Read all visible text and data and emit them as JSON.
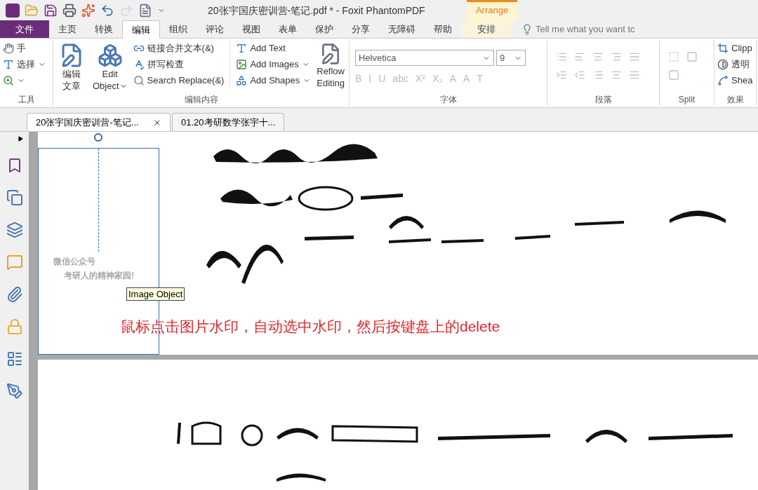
{
  "window": {
    "title": "20张宇国庆密训营-笔记.pdf * - Foxit PhantomPDF",
    "context_label": "Arrange"
  },
  "menu_tabs": [
    {
      "label": "文件",
      "kind": "file",
      "selected": false
    },
    {
      "label": "主页",
      "kind": "tab",
      "selected": false
    },
    {
      "label": "转换",
      "kind": "tab",
      "selected": false
    },
    {
      "label": "编辑",
      "kind": "tab",
      "selected": true
    },
    {
      "label": "组织",
      "kind": "tab",
      "selected": false
    },
    {
      "label": "评论",
      "kind": "tab",
      "selected": false
    },
    {
      "label": "视图",
      "kind": "tab",
      "selected": false
    },
    {
      "label": "表单",
      "kind": "tab",
      "selected": false
    },
    {
      "label": "保护",
      "kind": "tab",
      "selected": false
    },
    {
      "label": "分享",
      "kind": "tab",
      "selected": false
    },
    {
      "label": "无障碍",
      "kind": "tab",
      "selected": false
    },
    {
      "label": "帮助",
      "kind": "tab",
      "selected": false
    },
    {
      "label": "安排",
      "kind": "context",
      "selected": false
    }
  ],
  "tell_me": {
    "placeholder": "Tell me what you want tc"
  },
  "ribbon": {
    "tools": {
      "label": "工具",
      "items": [
        "手",
        "选择"
      ]
    },
    "edit_content": {
      "label": "编辑内容",
      "big": [
        [
          "编辑",
          "文章"
        ],
        [
          "Edit",
          "Object"
        ]
      ],
      "small": [
        "链接合并文本(&)",
        "拼写检查",
        "Search  Replace(&)"
      ],
      "add": [
        "Add Text",
        "Add Images",
        "Add Shapes"
      ],
      "reflow": [
        "Reflow",
        "Editing"
      ]
    },
    "font": {
      "label": "字体",
      "font_name": "Helvetica",
      "font_size": "9",
      "format_buttons": [
        {
          "label": "B",
          "disabled": true
        },
        {
          "label": "I",
          "disabled": true
        },
        {
          "label": "U",
          "disabled": true
        },
        {
          "label": "abc",
          "disabled": true
        },
        {
          "label": "X²",
          "disabled": true
        },
        {
          "label": "X₂",
          "disabled": true
        },
        {
          "label": "A",
          "disabled": true
        },
        {
          "label": "A",
          "disabled": true
        },
        {
          "label": "T",
          "disabled": true
        }
      ]
    },
    "paragraph": {
      "label": "段落"
    },
    "split": {
      "label": "Split"
    },
    "effects": {
      "label": "效果",
      "items": [
        "Clipp",
        "透明",
        "Shea"
      ]
    }
  },
  "doc_tabs": [
    {
      "label": "20张宇国庆密训营-笔记...",
      "selected": true
    },
    {
      "label": "01.20考研数学张宇十...",
      "selected": false
    }
  ],
  "page": {
    "watermark_lines": [
      "微信公众号",
      "考研人的精神家园!"
    ],
    "tooltip": "Image Object",
    "instruction": "鼠标点击图片水印，自动选中水印，然后按键盘上的delete"
  }
}
